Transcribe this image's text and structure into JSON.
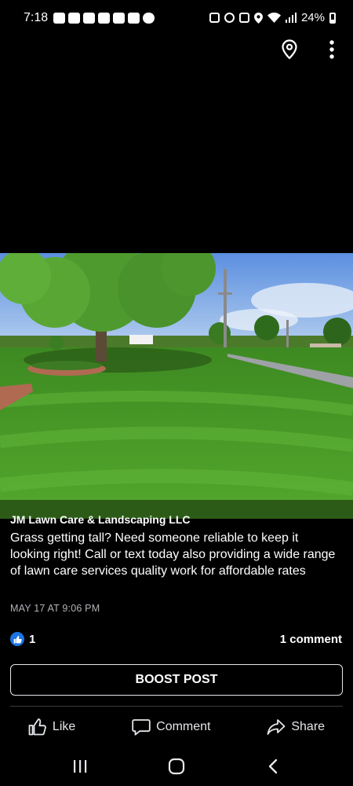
{
  "status_bar": {
    "time": "7:18",
    "battery": "24%",
    "left_icons": [
      "chat-icon",
      "n-icon",
      "youtube-icon",
      "youtube-icon",
      "gallery-icon",
      "bag-icon",
      "cloud-icon"
    ],
    "right_icons": [
      "nfc-icon",
      "alarm-icon",
      "mute-icon",
      "location-icon",
      "wifi-icon",
      "signal-icon",
      "battery-icon"
    ]
  },
  "top_actions": {
    "icons": [
      "location-pin-icon",
      "more-vertical-icon"
    ]
  },
  "photo": {
    "description_icon": "lawn-photo"
  },
  "post": {
    "page_name": "JM Lawn Care & Landscaping LLC",
    "text": "Grass getting tall? Need someone reliable to keep it looking right! Call or text today also providing a wide range of lawn care services quality work for affordable rates",
    "timestamp": "MAY 17 AT 9:06 PM",
    "reaction_count": "1",
    "comment_count": "1 comment",
    "boost_label": "BOOST POST"
  },
  "actions": {
    "like": "Like",
    "comment": "Comment",
    "share": "Share"
  },
  "colors": {
    "background": "#000000",
    "like_blue": "#1b74e4",
    "meta_gray": "#b0b3b8"
  }
}
